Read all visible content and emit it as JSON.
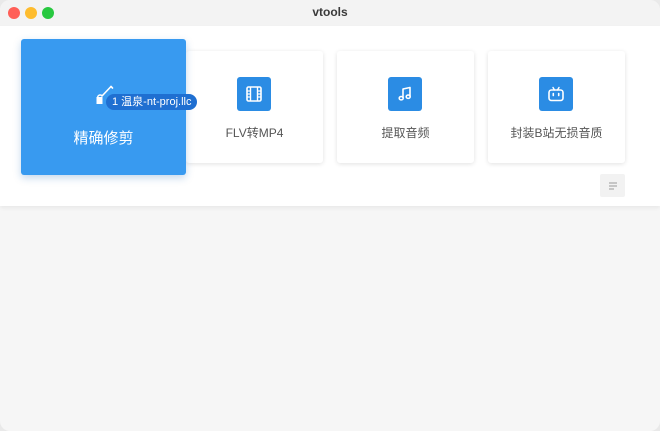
{
  "window": {
    "title": "vtools"
  },
  "tools": [
    {
      "label": "精确修剪",
      "icon": "brush-icon"
    },
    {
      "label": "FLV转MP4",
      "icon": "film-icon"
    },
    {
      "label": "提取音频",
      "icon": "music-note-icon"
    },
    {
      "label": "封装B站无损音质",
      "icon": "bilibili-tv-icon"
    }
  ],
  "drag": {
    "tag": "1 温泉-nt-proj.llc"
  },
  "colors": {
    "accent": "#389af0",
    "icon_box": "#2b8ce4",
    "drag_tag": "#1f6fd1"
  }
}
